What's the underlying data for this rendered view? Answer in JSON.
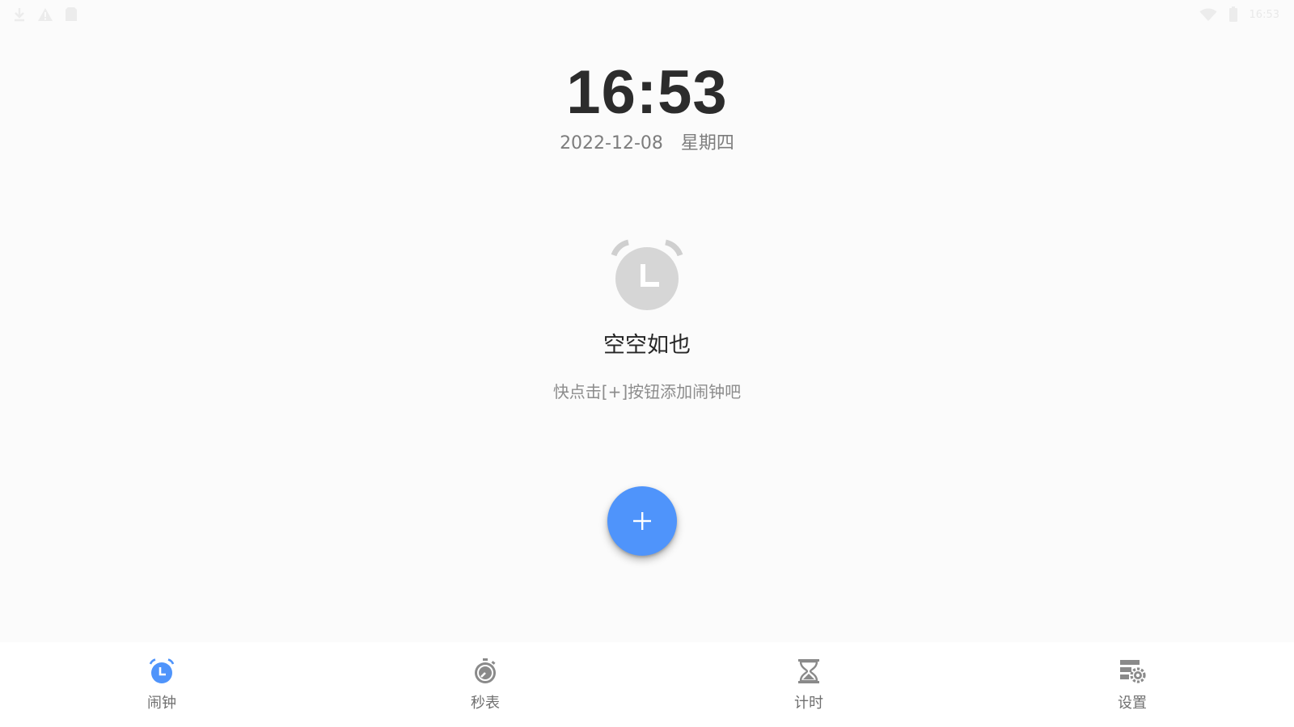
{
  "status_bar": {
    "left_icons": [
      "download-icon",
      "warning-icon",
      "sim-card-icon"
    ],
    "right_icons": [
      "wifi-icon",
      "battery-icon"
    ],
    "time": "16:53"
  },
  "clock": {
    "time": "16:53",
    "date": "2022-12-08",
    "weekday": "星期四"
  },
  "empty_state": {
    "icon": "alarm-clock-icon",
    "title": "空空如也",
    "hint": "快点击[+]按钮添加闹钟吧"
  },
  "fab": {
    "icon": "plus-icon",
    "color": "#4f94fb"
  },
  "bottom_nav": {
    "active_color": "#4f94fb",
    "inactive_color": "#8a8a8a",
    "items": [
      {
        "label": "闹钟",
        "icon": "alarm-clock-icon",
        "active": true
      },
      {
        "label": "秒表",
        "icon": "stopwatch-icon",
        "active": false
      },
      {
        "label": "计时",
        "icon": "hourglass-icon",
        "active": false
      },
      {
        "label": "设置",
        "icon": "settings-icon",
        "active": false
      }
    ]
  }
}
